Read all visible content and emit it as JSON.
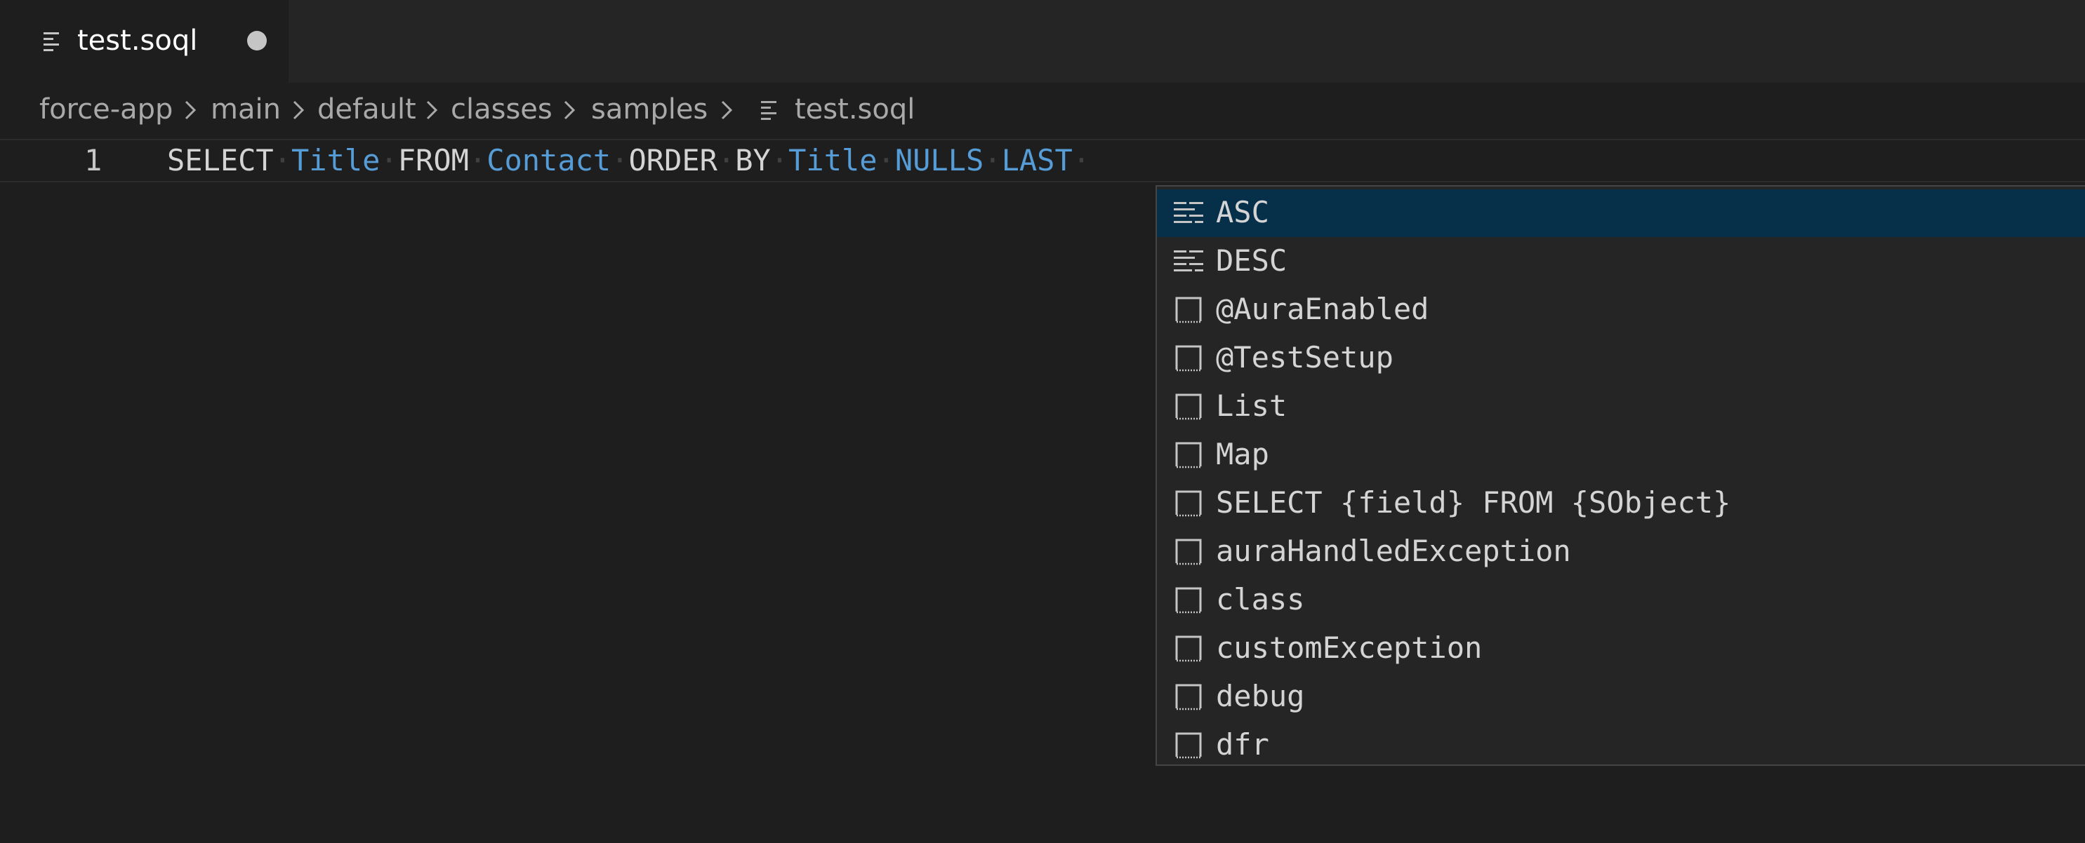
{
  "tab": {
    "icon": "file-lines-icon",
    "label": "test.soql",
    "dirty_icon": "unsaved-dot-icon"
  },
  "breadcrumb": {
    "items": [
      "force-app",
      "main",
      "default",
      "classes",
      "samples"
    ],
    "separator_icon": "chevron-right-icon",
    "file_icon": "file-lines-icon",
    "file": "test.soql"
  },
  "editor": {
    "line_number": "1",
    "tokens": [
      {
        "text": "SELECT",
        "kind": "keyword"
      },
      {
        "text": "Title",
        "kind": "identifier"
      },
      {
        "text": "FROM",
        "kind": "keyword"
      },
      {
        "text": "Contact",
        "kind": "identifier"
      },
      {
        "text": "ORDER",
        "kind": "keyword"
      },
      {
        "text": "BY",
        "kind": "keyword"
      },
      {
        "text": "Title",
        "kind": "identifier"
      },
      {
        "text": "NULLS",
        "kind": "identifier"
      },
      {
        "text": "LAST",
        "kind": "identifier"
      }
    ]
  },
  "suggestions": [
    {
      "label": "ASC",
      "icon": "keyword-icon",
      "selected": true
    },
    {
      "label": "DESC",
      "icon": "keyword-icon",
      "selected": false
    },
    {
      "label": "@AuraEnabled",
      "icon": "snippet-icon",
      "selected": false
    },
    {
      "label": "@TestSetup",
      "icon": "snippet-icon",
      "selected": false
    },
    {
      "label": "List",
      "icon": "snippet-icon",
      "selected": false
    },
    {
      "label": "Map",
      "icon": "snippet-icon",
      "selected": false
    },
    {
      "label": "SELECT {field} FROM {SObject}",
      "icon": "snippet-icon",
      "selected": false
    },
    {
      "label": "auraHandledException",
      "icon": "snippet-icon",
      "selected": false
    },
    {
      "label": "class",
      "icon": "snippet-icon",
      "selected": false
    },
    {
      "label": "customException",
      "icon": "snippet-icon",
      "selected": false
    },
    {
      "label": "debug",
      "icon": "snippet-icon",
      "selected": false
    },
    {
      "label": "dfr",
      "icon": "snippet-icon",
      "selected": false
    }
  ],
  "colors": {
    "background": "#1e1e1e",
    "tabbar": "#252526",
    "keyword": "#d4d4d4",
    "identifier": "#569cd6",
    "selection": "#062f4a"
  }
}
